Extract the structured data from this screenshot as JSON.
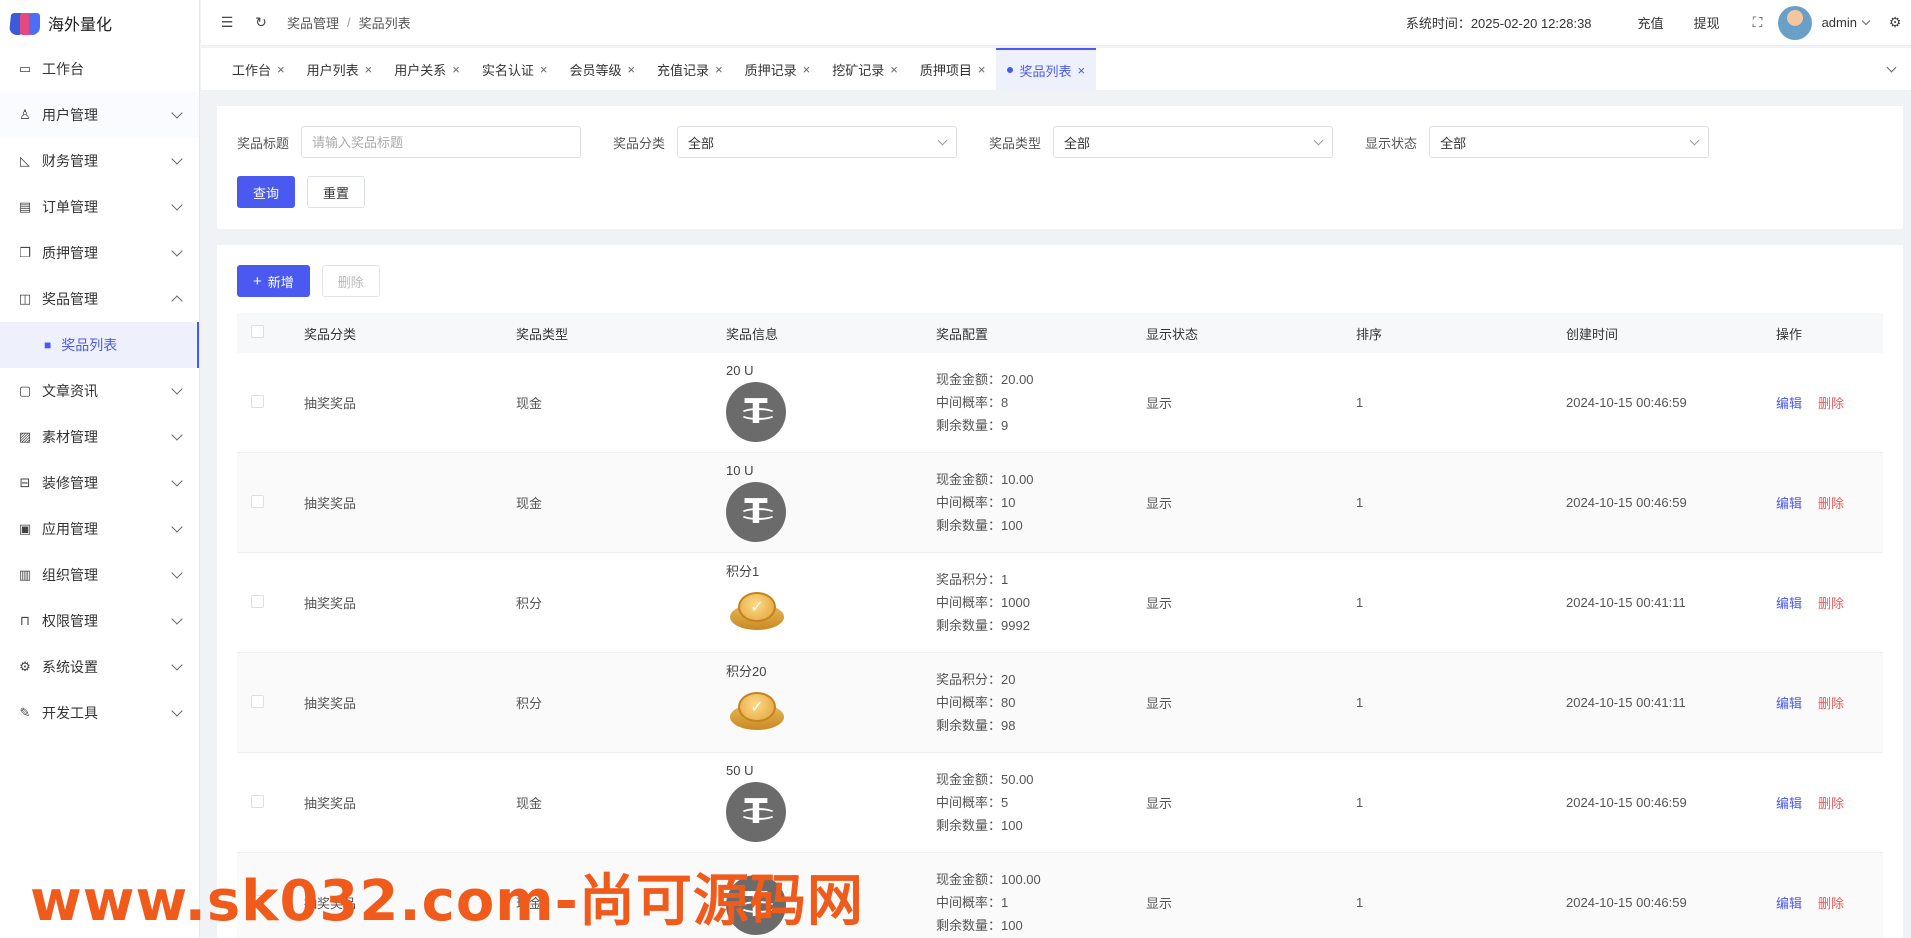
{
  "app": {
    "name": "海外量化"
  },
  "sidebar": {
    "items": [
      {
        "label": "工作台",
        "icon": "monitor-icon",
        "has_children": false
      },
      {
        "label": "用户管理",
        "icon": "user-icon",
        "has_children": true
      },
      {
        "label": "财务管理",
        "icon": "chart-icon",
        "has_children": true
      },
      {
        "label": "订单管理",
        "icon": "document-icon",
        "has_children": true
      },
      {
        "label": "质押管理",
        "icon": "copy-icon",
        "has_children": true
      },
      {
        "label": "奖品管理",
        "icon": "bag-icon",
        "has_children": true,
        "expanded": true
      },
      {
        "label": "文章资讯",
        "icon": "message-icon",
        "has_children": true
      },
      {
        "label": "素材管理",
        "icon": "image-icon",
        "has_children": true
      },
      {
        "label": "装修管理",
        "icon": "sofa-icon",
        "has_children": true
      },
      {
        "label": "应用管理",
        "icon": "app-icon",
        "has_children": true
      },
      {
        "label": "组织管理",
        "icon": "building-icon",
        "has_children": true
      },
      {
        "label": "权限管理",
        "icon": "lock-icon",
        "has_children": true
      },
      {
        "label": "系统设置",
        "icon": "gear-icon",
        "has_children": true
      },
      {
        "label": "开发工具",
        "icon": "pen-icon",
        "has_children": true
      }
    ],
    "sub_item": {
      "label": "奖品列表",
      "icon": "lock-icon"
    }
  },
  "header": {
    "breadcrumb": [
      "奖品管理",
      "奖品列表"
    ],
    "breadcrumb_sep": "/",
    "system_time_label": "系统时间：",
    "system_time": "2025-02-20 12:28:38",
    "recharge": "充值",
    "withdraw": "提现",
    "username": "admin"
  },
  "tabs": [
    {
      "label": "工作台",
      "active": false
    },
    {
      "label": "用户列表",
      "active": false
    },
    {
      "label": "用户关系",
      "active": false
    },
    {
      "label": "实名认证",
      "active": false
    },
    {
      "label": "会员等级",
      "active": false
    },
    {
      "label": "充值记录",
      "active": false
    },
    {
      "label": "质押记录",
      "active": false
    },
    {
      "label": "挖矿记录",
      "active": false
    },
    {
      "label": "质押项目",
      "active": false
    },
    {
      "label": "奖品列表",
      "active": true
    }
  ],
  "filters": {
    "title_label": "奖品标题",
    "title_placeholder": "请输入奖品标题",
    "category_label": "奖品分类",
    "category_value": "全部",
    "type_label": "奖品类型",
    "type_value": "全部",
    "status_label": "显示状态",
    "status_value": "全部",
    "query_button": "查询",
    "reset_button": "重置"
  },
  "toolbar": {
    "add_button": "新增",
    "delete_button": "删除"
  },
  "table": {
    "columns": [
      "奖品分类",
      "奖品类型",
      "奖品信息",
      "奖品配置",
      "显示状态",
      "排序",
      "创建时间",
      "操作"
    ],
    "rows": [
      {
        "category": "抽奖奖品",
        "type": "现金",
        "info_title": "20 U",
        "icon": "usdt-coin-icon",
        "cfg": [
          "现金金额：20.00",
          "中间概率：8",
          "剩余数量：9"
        ],
        "status": "显示",
        "sort": "1",
        "created": "2024-10-15 00:46:59",
        "edit": "编辑",
        "delete": "删除"
      },
      {
        "category": "抽奖奖品",
        "type": "现金",
        "info_title": "10 U",
        "icon": "usdt-coin-icon",
        "cfg": [
          "现金金额：10.00",
          "中间概率：10",
          "剩余数量：100"
        ],
        "status": "显示",
        "sort": "1",
        "created": "2024-10-15 00:46:59",
        "edit": "编辑",
        "delete": "删除"
      },
      {
        "category": "抽奖奖品",
        "type": "积分",
        "info_title": "积分1",
        "icon": "points-coin-icon",
        "cfg": [
          "奖品积分：1",
          "中间概率：1000",
          "剩余数量：9992"
        ],
        "status": "显示",
        "sort": "1",
        "created": "2024-10-15 00:41:11",
        "edit": "编辑",
        "delete": "删除"
      },
      {
        "category": "抽奖奖品",
        "type": "积分",
        "info_title": "积分20",
        "icon": "points-coin-icon",
        "cfg": [
          "奖品积分：20",
          "中间概率：80",
          "剩余数量：98"
        ],
        "status": "显示",
        "sort": "1",
        "created": "2024-10-15 00:41:11",
        "edit": "编辑",
        "delete": "删除"
      },
      {
        "category": "抽奖奖品",
        "type": "现金",
        "info_title": "50 U",
        "icon": "usdt-coin-icon",
        "cfg": [
          "现金金额：50.00",
          "中间概率：5",
          "剩余数量：100"
        ],
        "status": "显示",
        "sort": "1",
        "created": "2024-10-15 00:46:59",
        "edit": "编辑",
        "delete": "删除"
      },
      {
        "category": "抽奖奖品",
        "type": "现金",
        "info_title": "",
        "icon": "usdt-coin-icon",
        "cfg": [
          "现金金额：100.00",
          "中间概率：1",
          "剩余数量：100"
        ],
        "status": "显示",
        "sort": "1",
        "created": "2024-10-15 00:46:59",
        "edit": "编辑",
        "delete": "删除"
      }
    ]
  },
  "watermark": "www.sk032.com-尚可源码网",
  "colors": {
    "primary": "#4a5af0",
    "danger": "#f05a5a",
    "watermark": "#f05a1a"
  }
}
